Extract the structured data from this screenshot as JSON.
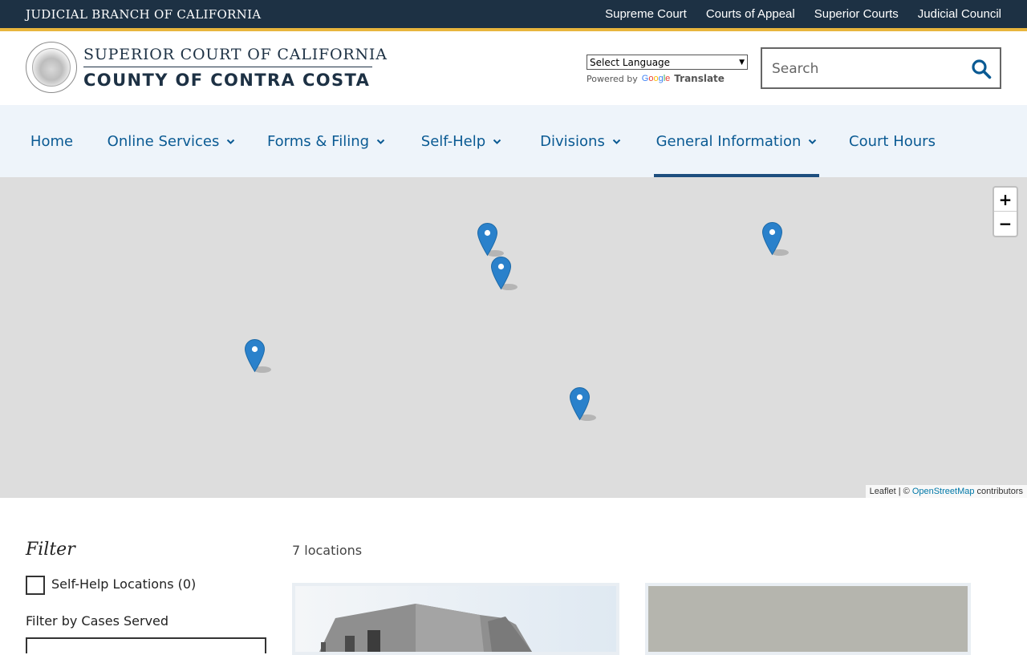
{
  "topbar": {
    "title": "JUDICIAL BRANCH OF CALIFORNIA",
    "links": [
      "Supreme Court",
      "Courts of Appeal",
      "Superior Courts",
      "Judicial Council"
    ]
  },
  "header": {
    "court_line1": "SUPERIOR COURT OF CALIFORNIA",
    "court_line2": "COUNTY OF CONTRA COSTA",
    "language_select": "Select Language",
    "powered_by": "Powered by",
    "google": "Google",
    "translate": "Translate",
    "search_placeholder": "Search"
  },
  "nav": {
    "items": [
      {
        "label": "Home",
        "dropdown": false,
        "active": false
      },
      {
        "label": "Online Services",
        "dropdown": true,
        "active": false
      },
      {
        "label": "Forms & Filing",
        "dropdown": true,
        "active": false
      },
      {
        "label": "Self-Help",
        "dropdown": true,
        "active": false
      },
      {
        "label": "Divisions",
        "dropdown": true,
        "active": false
      },
      {
        "label": "General Information",
        "dropdown": true,
        "active": true
      },
      {
        "label": "Court Hours",
        "dropdown": false,
        "active": false
      }
    ]
  },
  "map": {
    "zoom_in": "+",
    "zoom_out": "−",
    "attribution_leaflet": "Leaflet",
    "attribution_sep": " | © ",
    "attribution_osm": "OpenStreetMap",
    "attribution_tail": " contributors",
    "marker_count_visible": 5
  },
  "filter": {
    "title": "Filter",
    "self_help_label": "Self-Help Locations (0)",
    "cases_label": "Filter by Cases Served"
  },
  "results": {
    "count_label": "7 locations"
  },
  "colors": {
    "topbar": "#1d3144",
    "gold": "#e8b53d",
    "nav_bg": "#eef4fa",
    "nav_text": "#0a5a93",
    "map_bg": "#dddddd",
    "marker": "#2a81cb"
  }
}
